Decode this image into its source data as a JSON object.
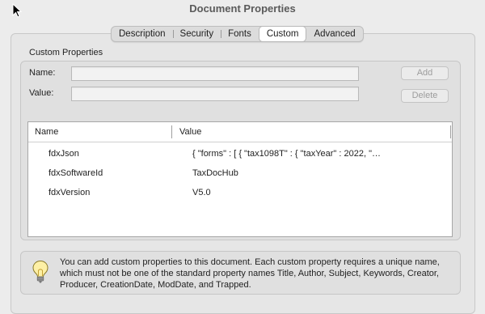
{
  "window": {
    "title": "Document Properties"
  },
  "tabs": [
    {
      "label": "Description",
      "active": false
    },
    {
      "label": "Security",
      "active": false
    },
    {
      "label": "Fonts",
      "active": false
    },
    {
      "label": "Custom",
      "active": true
    },
    {
      "label": "Advanced",
      "active": false
    }
  ],
  "custom": {
    "section_label": "Custom Properties",
    "name_label": "Name:",
    "name_value": "",
    "value_label": "Value:",
    "value_value": "",
    "add_label": "Add",
    "delete_label": "Delete"
  },
  "table": {
    "headers": {
      "name": "Name",
      "value": "Value"
    },
    "rows": [
      {
        "name": "fdxJson",
        "value": "{   \"forms\" : [ {     \"tax1098T\" : {       \"taxYear\" : 2022,       \"…"
      },
      {
        "name": "fdxSoftwareId",
        "value": "TaxDocHub"
      },
      {
        "name": "fdxVersion",
        "value": "V5.0"
      }
    ]
  },
  "info": {
    "icon": "lightbulb-icon",
    "text": "You can add custom properties to this document. Each custom property requires a unique name, which must not be one of the standard property names Title, Author, Subject, Keywords, Creator, Producer, CreationDate, ModDate, and Trapped."
  }
}
